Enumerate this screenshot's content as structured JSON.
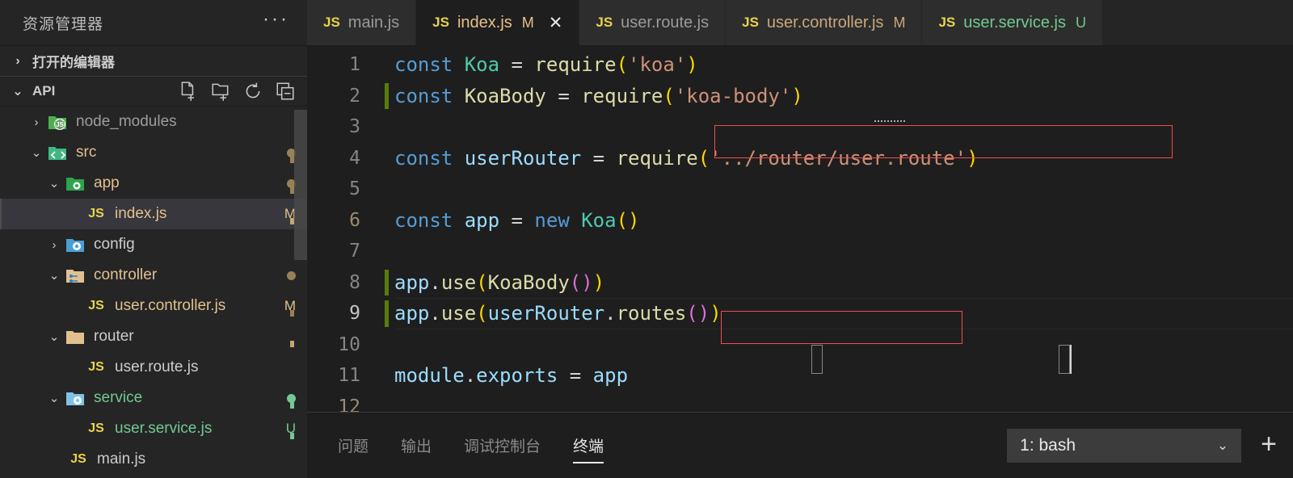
{
  "sidebar": {
    "title": "资源管理器",
    "more_label": "···",
    "open_editors_label": "打开的编辑器",
    "workspace_label": "API",
    "actions": [
      {
        "name": "new-file-icon",
        "tooltip": "新建文件"
      },
      {
        "name": "new-folder-icon",
        "tooltip": "新建文件夹"
      },
      {
        "name": "refresh-icon",
        "tooltip": "刷新"
      },
      {
        "name": "collapse-all-icon",
        "tooltip": "全部折叠"
      }
    ],
    "tree": [
      {
        "label": "node_modules",
        "indent": 1,
        "twisty": "›",
        "kind": "folder-node",
        "badge": "",
        "badge_color": "",
        "dot": "",
        "selected": false,
        "color": "#9d9d9d"
      },
      {
        "label": "src",
        "indent": 1,
        "twisty": "⌄",
        "kind": "folder-src",
        "badge": "",
        "badge_color": "",
        "dot": "#9a8057",
        "selected": false,
        "color": "#e2c08d"
      },
      {
        "label": "app",
        "indent": 2,
        "twisty": "⌄",
        "kind": "folder-app",
        "badge": "",
        "badge_color": "",
        "dot": "#9a8057",
        "selected": false,
        "color": "#e2c08d"
      },
      {
        "label": "index.js",
        "indent": 3,
        "twisty": "",
        "kind": "file-js",
        "badge": "M",
        "badge_color": "#e2c08d",
        "dot": "",
        "selected": true,
        "color": "#e2c08d"
      },
      {
        "label": "config",
        "indent": 2,
        "twisty": "›",
        "kind": "folder-config",
        "badge": "",
        "badge_color": "",
        "dot": "",
        "selected": false,
        "color": "#cccccc"
      },
      {
        "label": "controller",
        "indent": 2,
        "twisty": "⌄",
        "kind": "folder-controller",
        "badge": "",
        "badge_color": "",
        "dot": "#9a8057",
        "selected": false,
        "color": "#e2c08d"
      },
      {
        "label": "user.controller.js",
        "indent": 3,
        "twisty": "",
        "kind": "file-js",
        "badge": "M",
        "badge_color": "#e2c08d",
        "dot": "",
        "selected": false,
        "color": "#e2c08d"
      },
      {
        "label": "router",
        "indent": 2,
        "twisty": "⌄",
        "kind": "folder-plain",
        "badge": "",
        "badge_color": "",
        "dot": "",
        "selected": false,
        "color": "#cccccc"
      },
      {
        "label": "user.route.js",
        "indent": 3,
        "twisty": "",
        "kind": "file-js",
        "badge": "",
        "badge_color": "",
        "dot": "",
        "selected": false,
        "color": "#cccccc"
      },
      {
        "label": "service",
        "indent": 2,
        "twisty": "⌄",
        "kind": "folder-service",
        "badge": "",
        "badge_color": "",
        "dot": "#73c991",
        "selected": false,
        "color": "#73c991"
      },
      {
        "label": "user.service.js",
        "indent": 3,
        "twisty": "",
        "kind": "file-js",
        "badge": "U",
        "badge_color": "#73c991",
        "dot": "",
        "selected": false,
        "color": "#73c991"
      },
      {
        "label": "main.js",
        "indent": 2,
        "twisty": "",
        "kind": "file-js",
        "badge": "",
        "badge_color": "",
        "dot": "",
        "selected": false,
        "color": "#cccccc"
      }
    ]
  },
  "tabs": [
    {
      "label": "main.js",
      "icon": "JS",
      "dirty": "",
      "active": false,
      "closable": false,
      "color": "#9a9a9a"
    },
    {
      "label": "index.js",
      "icon": "JS",
      "dirty": "M",
      "active": true,
      "closable": true,
      "color": "#e7c08a"
    },
    {
      "label": "user.route.js",
      "icon": "JS",
      "dirty": "",
      "active": false,
      "closable": false,
      "color": "#9a9a9a"
    },
    {
      "label": "user.controller.js",
      "icon": "JS",
      "dirty": "M",
      "active": false,
      "closable": false,
      "color": "#c9a87c"
    },
    {
      "label": "user.service.js",
      "icon": "JS",
      "dirty": "U",
      "active": false,
      "closable": false,
      "color": "#73c991"
    }
  ],
  "editor": {
    "filename": "index.js",
    "language": "javascript",
    "lines": [
      {
        "n": "1",
        "gutter_added": false,
        "current": false
      },
      {
        "n": "2",
        "gutter_added": true,
        "current": false
      },
      {
        "n": "3",
        "gutter_added": false,
        "current": false
      },
      {
        "n": "4",
        "gutter_added": false,
        "current": false
      },
      {
        "n": "5",
        "gutter_added": false,
        "current": false
      },
      {
        "n": "6",
        "gutter_added": false,
        "current": false
      },
      {
        "n": "7",
        "gutter_added": false,
        "current": false
      },
      {
        "n": "8",
        "gutter_added": true,
        "current": false
      },
      {
        "n": "9",
        "gutter_added": true,
        "current": true
      },
      {
        "n": "10",
        "gutter_added": false,
        "current": false
      },
      {
        "n": "11",
        "gutter_added": false,
        "current": false
      },
      {
        "n": "12",
        "gutter_added": false,
        "current": false
      }
    ],
    "source": [
      "const Koa = require('koa')",
      "const KoaBody = require('koa-body')",
      "",
      "const userRouter = require('../router/user.route')",
      "",
      "const app = new Koa()",
      "",
      "app.use(KoaBody())",
      "app.use(userRouter.routes())",
      "",
      "module.exports = app",
      ""
    ],
    "annotations": [
      {
        "type": "highlight-box",
        "color": "#f14c4c",
        "target_line": "2",
        "text": "const KoaBody = require('koa-body')"
      },
      {
        "type": "highlight-box",
        "color": "#f14c4c",
        "target_line": "8",
        "text": "app.use(KoaBody())"
      }
    ]
  },
  "panel": {
    "tabs": [
      {
        "label": "问题",
        "active": false
      },
      {
        "label": "输出",
        "active": false
      },
      {
        "label": "调试控制台",
        "active": false
      },
      {
        "label": "终端",
        "active": true
      }
    ],
    "terminal_select": "1: bash",
    "chevron": "⌄",
    "add_label": "+"
  }
}
